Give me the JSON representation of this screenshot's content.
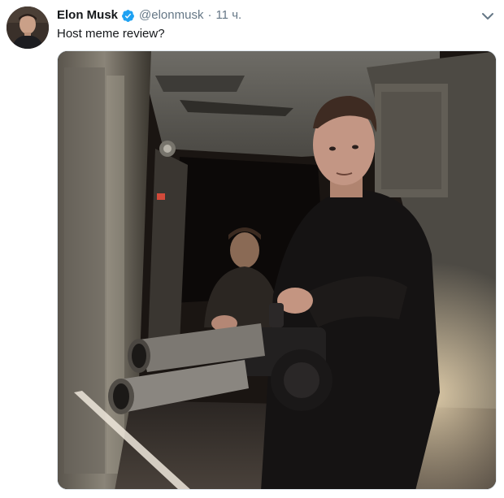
{
  "tweet": {
    "author_name": "Elon Musk",
    "handle": "@elonmusk",
    "separator": "·",
    "time": "11 ч.",
    "text": "Host meme review?",
    "verified_icon": "verified-badge-icon",
    "menu_icon": "chevron-down-icon",
    "colors": {
      "text": "#14171a",
      "secondary": "#657786",
      "verified": "#1da1f2"
    }
  }
}
